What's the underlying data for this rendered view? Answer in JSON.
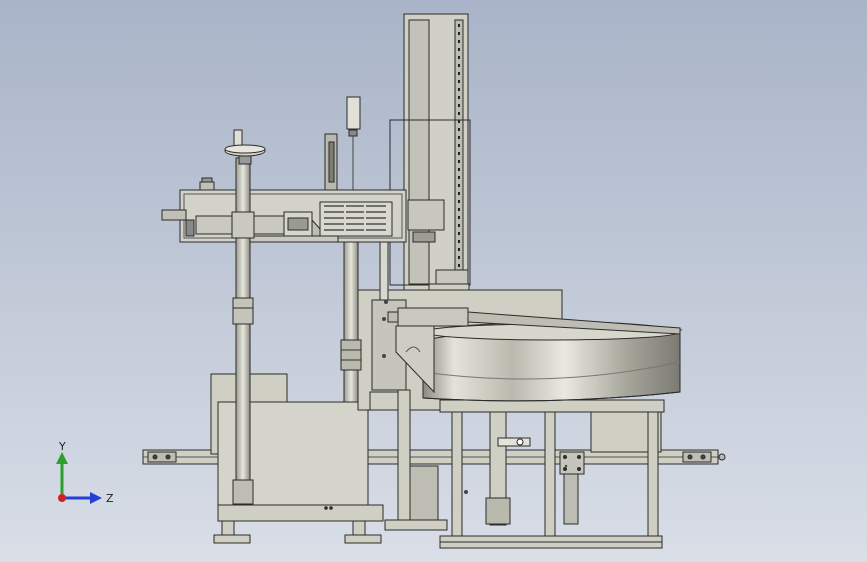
{
  "viewport": {
    "background_top": "#a9b4c8",
    "background_bottom": "#d9dee7",
    "part_color": "#cfcfc4",
    "edge_color": "#2b2b2b"
  },
  "axes": {
    "y_label": "Y",
    "z_label": "Z",
    "y_color": "#2e9e2e",
    "z_color": "#2440d8",
    "origin_color": "#d21f1f"
  }
}
